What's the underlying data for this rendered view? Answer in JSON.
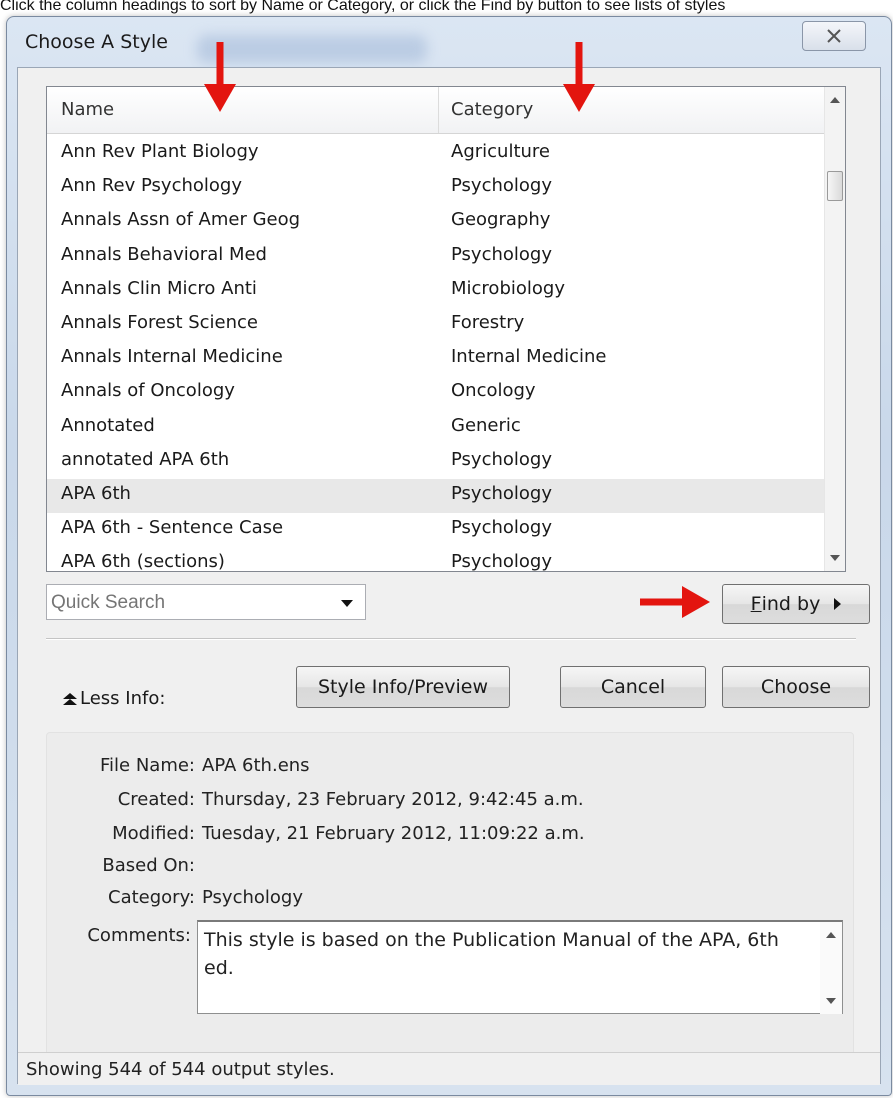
{
  "caption": "Click the column headings to sort by Name or Category, or click the Find by button to see lists of styles",
  "window": {
    "title": "Choose A Style"
  },
  "list": {
    "columns": {
      "name": "Name",
      "category": "Category"
    },
    "rows": [
      {
        "name": "Ann Rev Plant Biology",
        "category": "Agriculture"
      },
      {
        "name": "Ann Rev Psychology",
        "category": "Psychology"
      },
      {
        "name": "Annals Assn of Amer Geog",
        "category": "Geography"
      },
      {
        "name": "Annals Behavioral Med",
        "category": "Psychology"
      },
      {
        "name": "Annals Clin Micro Anti",
        "category": "Microbiology"
      },
      {
        "name": "Annals Forest Science",
        "category": "Forestry"
      },
      {
        "name": "Annals Internal Medicine",
        "category": "Internal Medicine"
      },
      {
        "name": "Annals of Oncology",
        "category": "Oncology"
      },
      {
        "name": "Annotated",
        "category": "Generic"
      },
      {
        "name": "annotated APA 6th",
        "category": "Psychology"
      },
      {
        "name": "APA 6th",
        "category": "Psychology"
      },
      {
        "name": "APA 6th - Sentence Case",
        "category": "Psychology"
      },
      {
        "name": "APA 6th (sections)",
        "category": "Psychology"
      }
    ],
    "selected_row": "APA 6th"
  },
  "search": {
    "placeholder": "Quick Search"
  },
  "buttons": {
    "find_by_mnemonic": "F",
    "find_by_rest": "ind by",
    "style_info": "Style Info/Preview",
    "cancel": "Cancel",
    "choose": "Choose",
    "less_info": "Less Info:"
  },
  "info": {
    "labels": {
      "file_name": "File Name:",
      "created": "Created:",
      "modified": "Modified:",
      "based_on": "Based On:",
      "category": "Category:",
      "comments": "Comments:"
    },
    "values": {
      "file_name": "APA 6th.ens",
      "created": "Thursday, 23 February 2012, 9:42:45 a.m.",
      "modified": "Tuesday, 21 February 2012, 11:09:22 a.m.",
      "based_on": "",
      "category": "Psychology",
      "comments": "This style is based on the Publication Manual of the APA, 6th ed."
    }
  },
  "status": "Showing 544 of 544 output styles.",
  "colors": {
    "annotation_arrow": "#e3150f",
    "selected_row": "#e8e8e8"
  },
  "icons": [
    "close-icon",
    "scroll-up-icon",
    "scroll-down-icon",
    "dropdown-arrow-icon",
    "submenu-arrow-icon",
    "double-up-arrow-icon",
    "annotation-arrow-icon"
  ]
}
